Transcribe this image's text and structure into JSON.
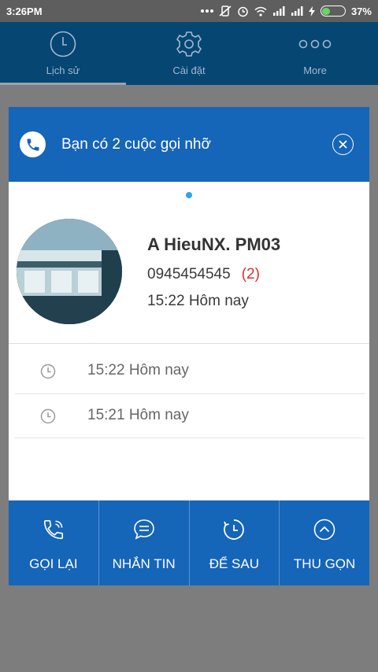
{
  "status": {
    "time": "3:26PM",
    "battery": "37%",
    "battery_level": 0.37
  },
  "tabs": [
    {
      "label": "Lịch sử",
      "icon": "clock-icon",
      "active": true
    },
    {
      "label": "Cài đặt",
      "icon": "gear-icon",
      "active": false
    },
    {
      "label": "More",
      "icon": "more-dots-icon",
      "active": false
    }
  ],
  "dialog": {
    "title": "Bạn có 2 cuộc gọi nhỡ",
    "header_icon": "phone-icon",
    "close_icon": "close-icon",
    "contact": {
      "name": "A HieuNX. PM03",
      "phone": "0945454545",
      "missed_count": "(2)",
      "time": "15:22 Hôm nay"
    },
    "calls": [
      {
        "time": "15:22 Hôm nay"
      },
      {
        "time": "15:21 Hôm nay"
      }
    ],
    "actions": [
      {
        "label": "GỌI LẠI",
        "icon": "phone-icon"
      },
      {
        "label": "NHẮN TIN",
        "icon": "message-icon"
      },
      {
        "label": "ĐỂ SAU",
        "icon": "snooze-clock-icon"
      },
      {
        "label": "THU GỌN",
        "icon": "chevron-up-icon"
      }
    ]
  },
  "colors": {
    "header_blue": "#1565b9",
    "tab_bar": "#064673",
    "missed_count_red": "#d9302c",
    "page_indicator": "#2fa3ef"
  }
}
